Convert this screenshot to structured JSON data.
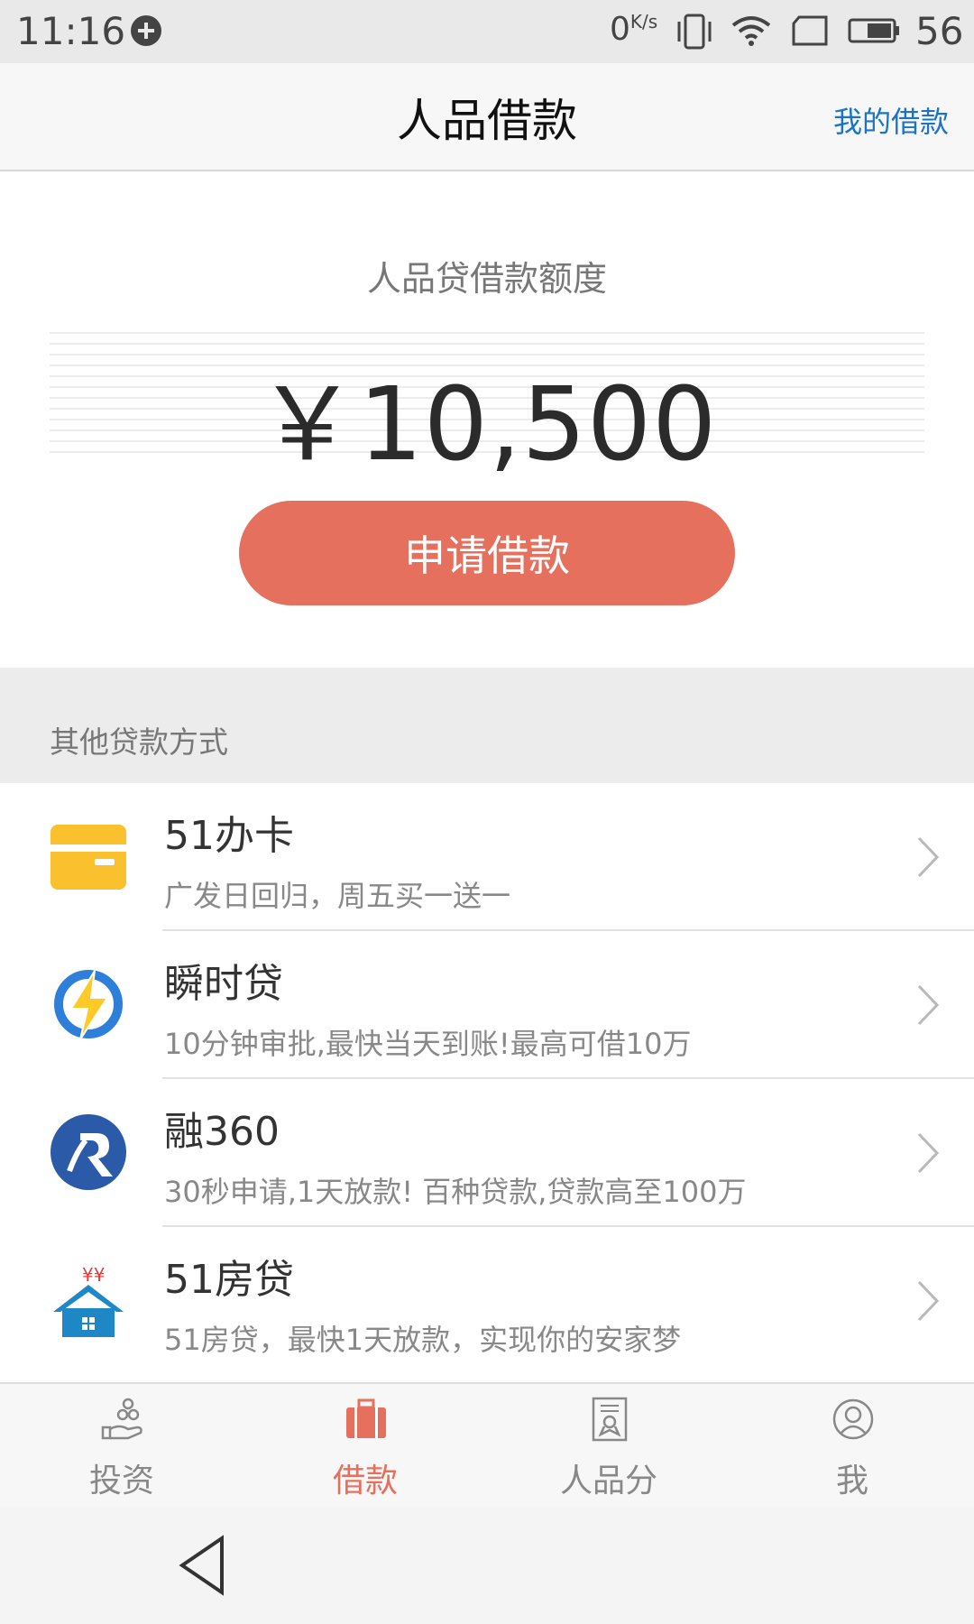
{
  "status_bar": {
    "time": "11:16",
    "net_speed": "0",
    "net_unit": "K/s",
    "battery_level": "56"
  },
  "header": {
    "title": "人品借款",
    "my_loans_link": "我的借款"
  },
  "quota": {
    "label": "人品贷借款额度",
    "amount": "￥10,500",
    "apply_button": "申请借款"
  },
  "other_loans": {
    "section_title": "其他贷款方式",
    "items": [
      {
        "name": "51办卡",
        "desc": "广发日回归，周五买一送一",
        "icon": "card-icon"
      },
      {
        "name": "瞬时贷",
        "desc": "10分钟审批,最快当天到账!最高可借10万",
        "icon": "lightning-icon"
      },
      {
        "name": "融360",
        "desc": "30秒申请,1天放款! 百种贷款,贷款高至100万",
        "icon": "rong360-logo-icon"
      },
      {
        "name": "51房贷",
        "desc": "51房贷，最快1天放款，实现你的安家梦",
        "icon": "house-icon"
      }
    ]
  },
  "bottom_nav": {
    "items": [
      {
        "label": "投资",
        "icon": "invest-icon",
        "active": false
      },
      {
        "label": "借款",
        "icon": "briefcase-icon",
        "active": true
      },
      {
        "label": "人品分",
        "icon": "certificate-icon",
        "active": false
      },
      {
        "label": "我",
        "icon": "user-icon",
        "active": false
      }
    ]
  },
  "colors": {
    "accent": "#e4705d",
    "link": "#1a73c9",
    "card_yellow": "#fbc02d",
    "house_blue": "#1e88c7"
  }
}
